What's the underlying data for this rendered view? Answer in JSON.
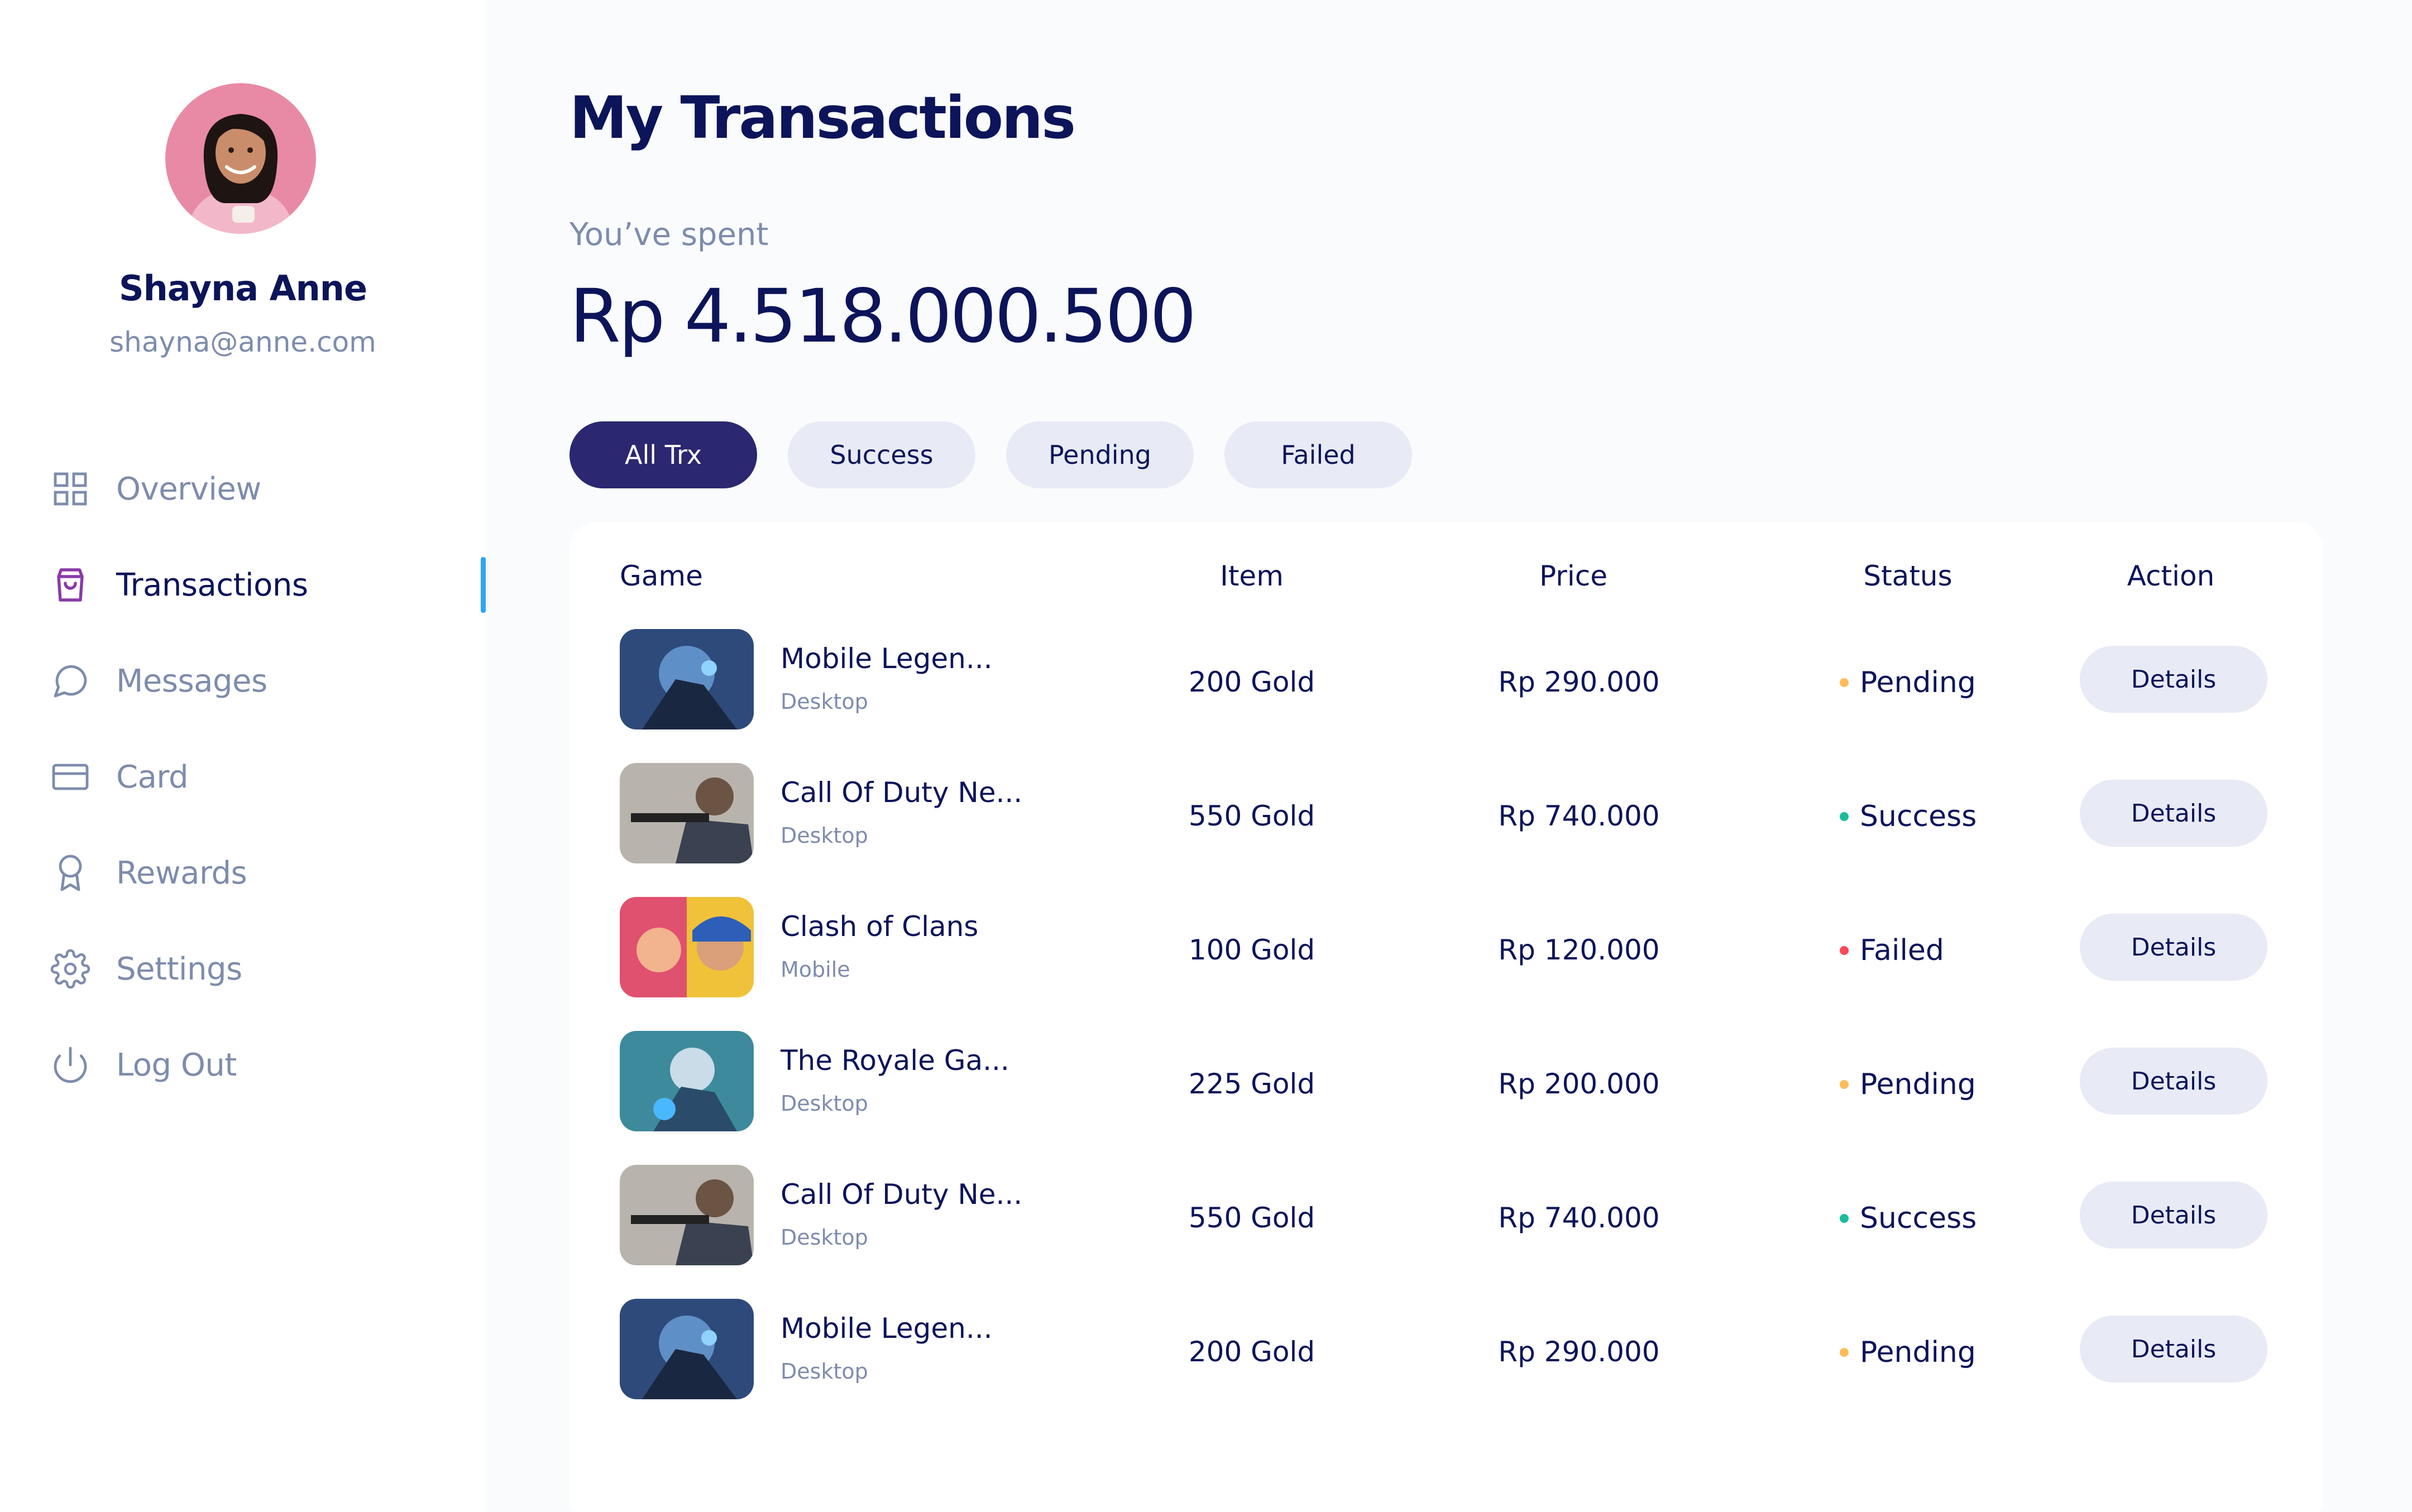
{
  "profile": {
    "name": "Shayna Anne",
    "email": "shayna@anne.com"
  },
  "nav": {
    "items": [
      {
        "label": "Overview",
        "icon": "grid-icon"
      },
      {
        "label": "Transactions",
        "icon": "shopping-bag-icon",
        "active": true
      },
      {
        "label": "Messages",
        "icon": "message-icon"
      },
      {
        "label": "Card",
        "icon": "credit-card-icon"
      },
      {
        "label": "Rewards",
        "icon": "award-icon"
      },
      {
        "label": "Settings",
        "icon": "gear-icon"
      },
      {
        "label": "Log Out",
        "icon": "power-icon"
      }
    ]
  },
  "main": {
    "title": "My Transactions",
    "spent_label": "You’ve spent",
    "spent_amount": "Rp 4.518.000.500",
    "filters": [
      "All Trx",
      "Success",
      "Pending",
      "Failed"
    ],
    "active_filter": "All Trx"
  },
  "table": {
    "headers": [
      "Game",
      "Item",
      "Price",
      "Status",
      "Action"
    ],
    "rows": [
      {
        "game": "Mobile Legen...",
        "platform": "Desktop",
        "item": "200 Gold",
        "price": "Rp 290.000",
        "status": "Pending",
        "action": "Details"
      },
      {
        "game": "Call Of Duty Ne...",
        "platform": "Desktop",
        "item": "550 Gold",
        "price": "Rp 740.000",
        "status": "Success",
        "action": "Details"
      },
      {
        "game": "Clash of Clans",
        "platform": "Mobile",
        "item": "100 Gold",
        "price": "Rp 120.000",
        "status": "Failed",
        "action": "Details"
      },
      {
        "game": "The Royale Ga...",
        "platform": "Desktop",
        "item": "225 Gold",
        "price": "Rp 200.000",
        "status": "Pending",
        "action": "Details"
      },
      {
        "game": "Call Of Duty Ne...",
        "platform": "Desktop",
        "item": "550 Gold",
        "price": "Rp 740.000",
        "status": "Success",
        "action": "Details"
      },
      {
        "game": "Mobile Legen...",
        "platform": "Desktop",
        "item": "200 Gold",
        "price": "Rp 290.000",
        "status": "Pending",
        "action": "Details"
      }
    ]
  },
  "colors": {
    "navy": "#0c145a",
    "muted": "#7e8cac",
    "accent": "#2b2770",
    "indicator": "#2fa6f1",
    "pending": "#febc59",
    "success": "#1abc9c",
    "failed": "#fe4857"
  }
}
